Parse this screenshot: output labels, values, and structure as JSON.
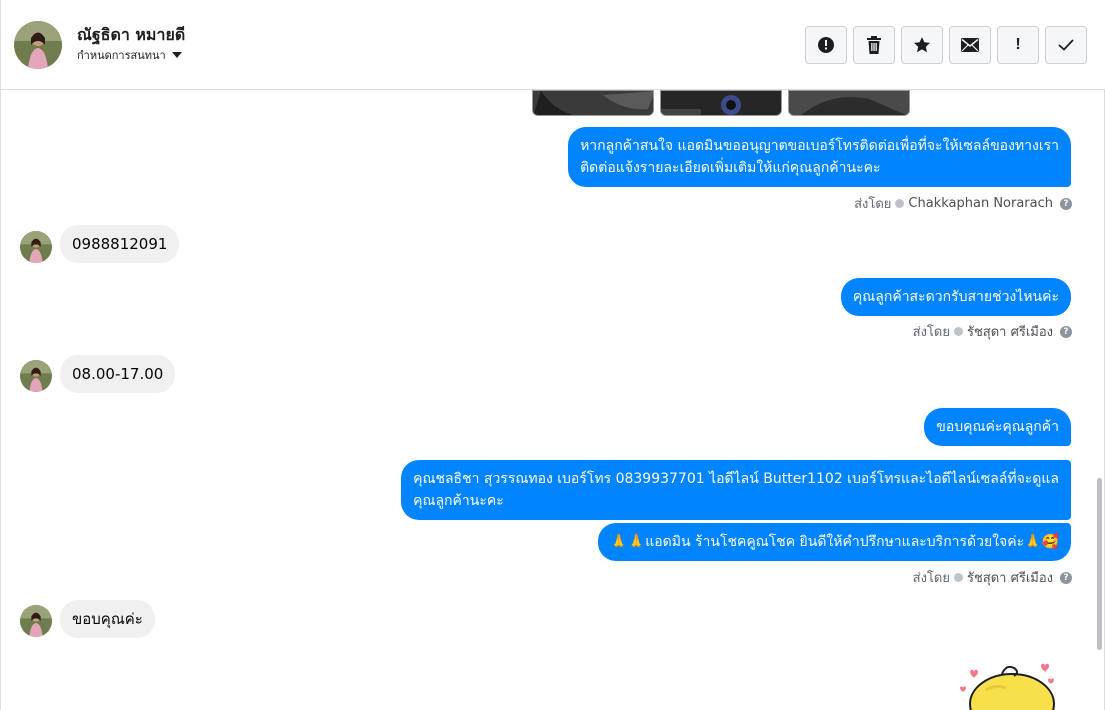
{
  "header": {
    "contact_name": "ณัฐธิดา หมายดี",
    "assign_label": "กำหนดการสนทนา"
  },
  "toolbar": {
    "buttons": [
      {
        "icon": "alert-circle-icon",
        "glyph": "!"
      },
      {
        "icon": "trash-icon"
      },
      {
        "icon": "star-icon",
        "glyph": "★"
      },
      {
        "icon": "envelope-icon"
      },
      {
        "icon": "exclamation-icon",
        "glyph": "!"
      },
      {
        "icon": "check-icon",
        "glyph": "✓"
      }
    ]
  },
  "messages": {
    "m1": {
      "line1": "หากลูกค้าสนใจ แอดมินขออนุญาตขอเบอร์โทรติดต่อเพื่อที่จะให้เซลล์ของทางเรา",
      "line2": "ติดต่อแจ้งรายละเอียดเพิ่มเติมให้แก่คุณลูกค้านะคะ"
    },
    "sent1": {
      "prefix": "ส่งโดย",
      "sender": "Chakkaphan Norarach",
      "help": "?"
    },
    "m2": {
      "text": "0988812091"
    },
    "m3": {
      "text": "คุณลูกค้าสะดวกรับสายช่วงไหนค่ะ"
    },
    "sent2": {
      "prefix": "ส่งโดย",
      "sender": "รัชสุดา ศรีเมือง",
      "help": "?"
    },
    "m4": {
      "text": "08.00-17.00"
    },
    "m5": {
      "text": "ขอบคุณค่ะคุณลูกค้า"
    },
    "m6": {
      "line1": "คุณชลธิชา สุวรรณทอง   เบอร์โทร 0839937701  ไอดีไลน์ Butter1102   เบอร์โทรและไอดีไลน์เซลล์ที่จะดูแล",
      "line2": "คุณลูกค้านะคะ"
    },
    "m7": {
      "text": "🙏🙏แอดมิน ร้านโชคคูณโชค ยินดีให้คำปรึกษาและบริการด้วยใจค่ะ🙏🥰"
    },
    "sent3": {
      "prefix": "ส่งโดย",
      "sender": "รัชสุดา ศรีเมือง",
      "help": "?"
    },
    "m8": {
      "text": "ขอบคุณค่ะ"
    }
  },
  "colors": {
    "outgoing": "#0084ff",
    "incoming": "#f0f0f0",
    "meta": "#606770"
  }
}
